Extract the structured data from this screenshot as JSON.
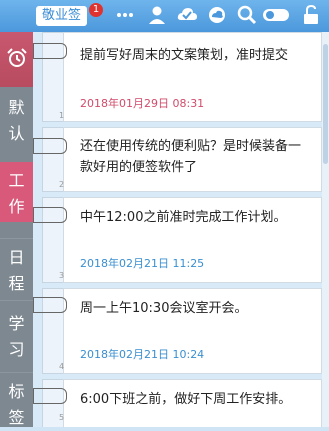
{
  "toolbar": {
    "brand": "敬业签",
    "badge": "1",
    "icons": [
      "more-icon",
      "user-icon",
      "check-cloud-icon",
      "cloud-icon",
      "search-icon",
      "toggle-icon",
      "lock-icon"
    ]
  },
  "sidebar": {
    "alarm_icon": "alarm-clock-icon",
    "categories": [
      {
        "label": "默认",
        "active": false
      },
      {
        "label": "工作",
        "active": true
      },
      {
        "label": "日程",
        "active": false
      },
      {
        "label": "学习",
        "active": false
      },
      {
        "label": "标签",
        "active": false
      }
    ]
  },
  "notes": [
    {
      "number": "1",
      "text": "提前写好周末的文案策划，准时提交",
      "date": "2018年01月29日 08:31",
      "date_color": "#d24b6a"
    },
    {
      "number": "2",
      "text": "还在使用传统的便利贴？是时候装备一款好用的便签软件了",
      "date": "",
      "date_color": ""
    },
    {
      "number": "3",
      "text": "中午12:00之前准时完成工作计划。",
      "date": "2018年02月21日 11:25",
      "date_color": "#3a8fd0"
    },
    {
      "number": "4",
      "text": "周一上午10:30会议室开会。",
      "date": "2018年02月21日 10:24",
      "date_color": "#3a8fd0"
    },
    {
      "number": "5",
      "text": "6:00下班之前，做好下周工作安排。",
      "date": "",
      "date_color": ""
    }
  ]
}
